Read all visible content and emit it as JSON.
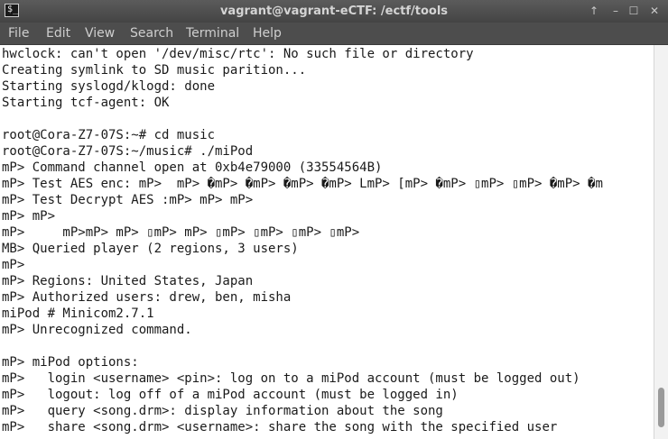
{
  "window": {
    "icon_glyph": "$_",
    "title": "vagrant@vagrant-eCTF: /ectf/tools",
    "controls": {
      "up": "↑",
      "minimize": "–",
      "maximize": "☐",
      "close": "✕"
    }
  },
  "menu": {
    "items": [
      {
        "label": "File"
      },
      {
        "label": "Edit"
      },
      {
        "label": "View"
      },
      {
        "label": "Search"
      },
      {
        "label": "Terminal"
      },
      {
        "label": "Help"
      }
    ]
  },
  "terminal": {
    "lines": [
      "hwclock: can't open '/dev/misc/rtc': No such file or directory",
      "Creating symlink to SD music parition...",
      "Starting syslogd/klogd: done",
      "Starting tcf-agent: OK",
      "",
      "root@Cora-Z7-07S:~# cd music",
      "root@Cora-Z7-07S:~/music# ./miPod",
      "mP> Command channel open at 0xb4e79000 (33554564B)",
      "mP> Test AES enc: mP>  mP> �mP> �mP> �mP> �mP> LmP> [mP> �mP> ▯mP> ▯mP> �mP> �m",
      "mP> Test Decrypt AES :mP> mP> mP>",
      "mP> mP>",
      "mP>     mP>mP> mP> ▯mP> mP> ▯mP> ▯mP> ▯mP> ▯mP>",
      "MB> Queried player (2 regions, 3 users)",
      "mP>",
      "mP> Regions: United States, Japan",
      "mP> Authorized users: drew, ben, misha",
      "miPod # Minicom2.7.1",
      "mP> Unrecognized command.",
      "",
      "mP> miPod options:",
      "mP>   login <username> <pin>: log on to a miPod account (must be logged out)",
      "mP>   logout: log off of a miPod account (must be logged in)",
      "mP>   query <song.drm>: display information about the song",
      "mP>   share <song.drm> <username>: share the song with the specified user"
    ]
  }
}
